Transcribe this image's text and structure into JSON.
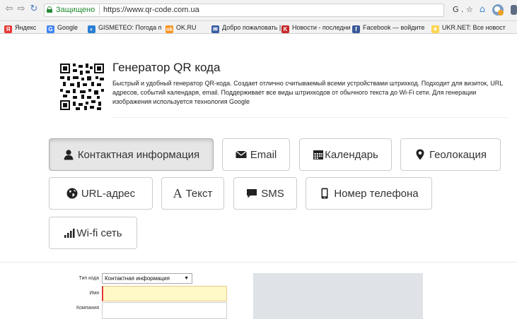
{
  "browser": {
    "secure_label": "Защищено",
    "url": "https://www.qr-code.com.ua",
    "ext_text": "G . ☆"
  },
  "bookmarks": [
    {
      "label": "Яндекс",
      "color": "#e53935",
      "glyph": "Я"
    },
    {
      "label": "Google",
      "color": "#4285f4",
      "glyph": "G"
    },
    {
      "label": "GISMETEO: Погода п",
      "color": "#2b7fd4",
      "glyph": "◐"
    },
    {
      "label": "OK.RU",
      "color": "#f7931e",
      "glyph": "ok"
    },
    {
      "label": "Добро пожаловать |",
      "color": "#3b5fa3",
      "glyph": "✉"
    },
    {
      "label": "Новости - последни",
      "color": "#c62828",
      "glyph": "K"
    },
    {
      "label": "Facebook — войдите",
      "color": "#3b5998",
      "glyph": "f"
    },
    {
      "label": "UKR.NET: Все новост",
      "color": "#ffd54f",
      "glyph": "✶"
    }
  ],
  "header": {
    "title": "Генератор QR кода",
    "description": "Быстрый и удобный генератор QR-кода. Создает отлично считываемый всеми устройствами штрихкод. Подходит для визиток, URL адресов, событий календаря, email. Поддерживает все виды штрихкодов от обычного текста до Wi-Fi сети. Для генерации изображения используется технология Google"
  },
  "type_buttons": [
    {
      "label": "Контактная информация",
      "icon": "user-icon",
      "active": true
    },
    {
      "label": "Email",
      "icon": "envelope-icon"
    },
    {
      "label": "Календарь",
      "icon": "calendar-icon"
    },
    {
      "label": "Геолокация",
      "icon": "map-marker-icon"
    },
    {
      "label": "URL-адрес",
      "icon": "globe-icon"
    },
    {
      "label": "Текст",
      "icon": "font-icon",
      "icon_text": "A"
    },
    {
      "label": "SMS",
      "icon": "comment-icon"
    },
    {
      "label": "Номер телефона",
      "icon": "phone-icon"
    },
    {
      "label": "Wi-fi сеть",
      "icon": "signal-icon"
    }
  ],
  "form": {
    "type_label": "Тип кода",
    "type_value": "Контактная информация",
    "name_label": "Имя",
    "company_label": "Компания"
  },
  "colors": {
    "accent_secure": "#1f8a2e",
    "active_button_bg": "#e6e6e6",
    "focused_input_bg": "#fff9c7"
  }
}
